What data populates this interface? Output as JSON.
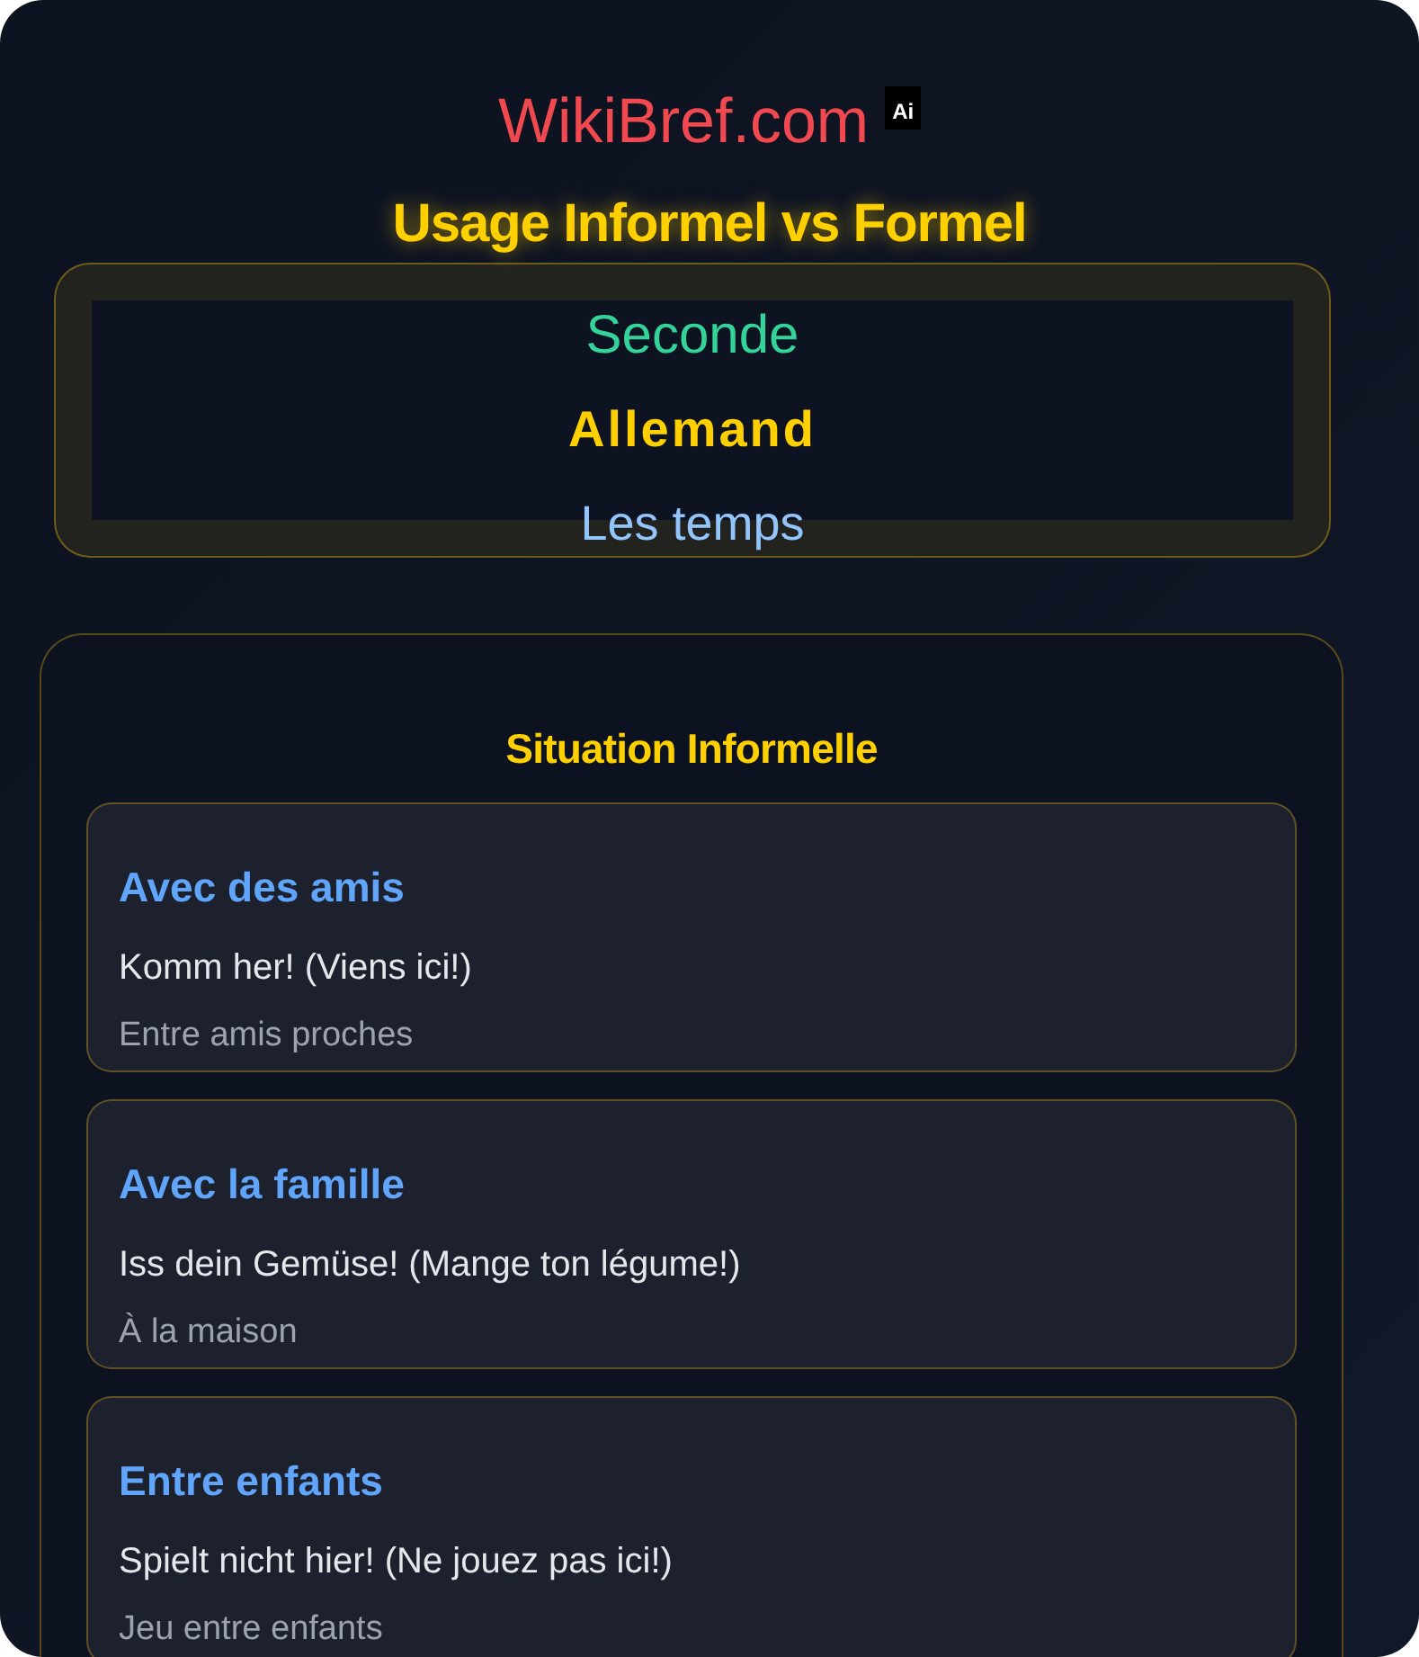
{
  "brand": {
    "name": "WikiBref.com",
    "badge": "Ai"
  },
  "title": "Usage Informel vs Formel",
  "subject": {
    "level": "Seconde",
    "language": "Allemand",
    "topic": "Les temps"
  },
  "sections": [
    {
      "heading": "Situation Informelle",
      "items": [
        {
          "context": "Avec des amis",
          "phrase": "Komm her! (Viens ici!)",
          "note": "Entre amis proches"
        },
        {
          "context": "Avec la famille",
          "phrase": "Iss dein Gemüse! (Mange ton légume!)",
          "note": "À la maison"
        },
        {
          "context": "Entre enfants",
          "phrase": "Spielt nicht hier! (Ne jouez pas ici!)",
          "note": "Jeu entre enfants"
        }
      ]
    }
  ]
}
